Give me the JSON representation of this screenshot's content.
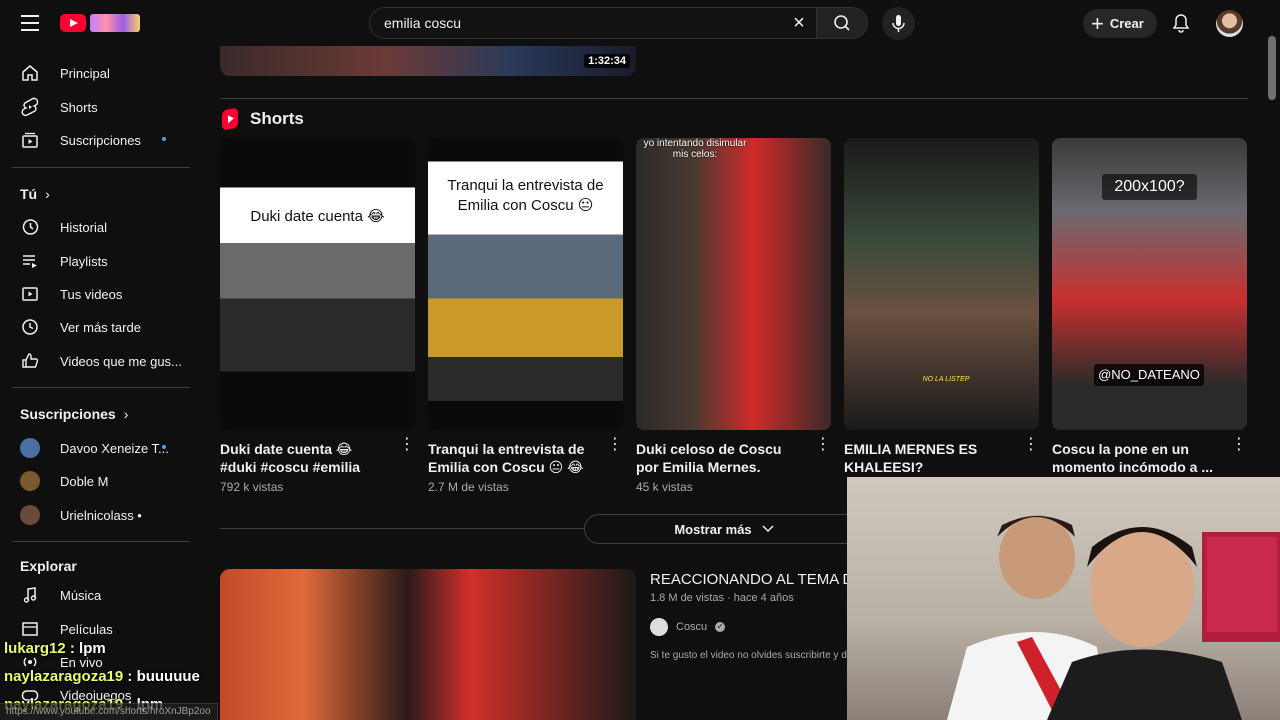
{
  "search": {
    "value": "emilia coscu"
  },
  "header": {
    "create_label": "Crear"
  },
  "sidebar": {
    "main_items": [
      {
        "label": "Principal",
        "icon": "home-icon"
      },
      {
        "label": "Shorts",
        "icon": "shorts-icon"
      },
      {
        "label": "Suscripciones",
        "icon": "subscriptions-icon"
      }
    ],
    "you_heading": "Tú",
    "you_items": [
      {
        "label": "Historial",
        "icon": "history-icon"
      },
      {
        "label": "Playlists",
        "icon": "playlists-icon"
      },
      {
        "label": "Tus videos",
        "icon": "your-videos-icon"
      },
      {
        "label": "Ver más tarde",
        "icon": "watch-later-icon"
      },
      {
        "label": "Videos que me gus...",
        "icon": "liked-icon"
      }
    ],
    "subs_heading": "Suscripciones",
    "subs_items": [
      {
        "label": "Davoo Xeneize T...",
        "color": "#4a6fa5"
      },
      {
        "label": "Doble M",
        "color": "#7a5a2a"
      },
      {
        "label": "Urielnicolass •",
        "color": "#6a4a3a"
      }
    ],
    "explore_heading": "Explorar",
    "explore_items": [
      {
        "label": "Música",
        "icon": "music-icon"
      },
      {
        "label": "Películas",
        "icon": "movies-icon"
      },
      {
        "label": "En vivo",
        "icon": "live-icon"
      },
      {
        "label": "Videojuegos",
        "icon": "gaming-icon"
      }
    ]
  },
  "previous_video": {
    "duration": "1:32:34"
  },
  "shorts": {
    "heading": "Shorts",
    "items": [
      {
        "caption": "Duki date cuenta 😂",
        "title": "Duki date cuenta 😂 #duki #coscu #emilia",
        "views": "792 k vistas"
      },
      {
        "caption": "Tranqui la entrevista de Emilia con Coscu 😐",
        "title": "Tranqui la entrevista de Emilia con Coscu 😐 😂",
        "views": "2.7 M de vistas"
      },
      {
        "caption": "yo intentando disimular mis celos:",
        "title": "Duki celoso de Coscu por Emilia Mernes.",
        "views": "45 k vistas"
      },
      {
        "caption": "NO LA LISTEP",
        "title": "EMILIA MERNES ES KHALEESI?",
        "views": ""
      },
      {
        "caption": "200x100?",
        "caption2": "@NO_DATEANO",
        "title": "Coscu la pone en un momento incómodo a ...",
        "views": ""
      }
    ]
  },
  "show_more_label": "Mostrar más",
  "video": {
    "title": "REACCIONANDO AL TEMA DE",
    "meta": "1.8 M de vistas · hace 4 años",
    "channel": "Coscu",
    "description": "Si te gusto el video no olvides suscribirte y d"
  },
  "chat": [
    {
      "user": "lukarg12",
      "message": ": lpm"
    },
    {
      "user": "naylazaragoza19",
      "message": ": buuuuue"
    },
    {
      "user": "naylazaragoza19",
      "message": ": lpm"
    }
  ],
  "status_url": "https://www.youtube.com/shorts/hroXnJBp2oo"
}
